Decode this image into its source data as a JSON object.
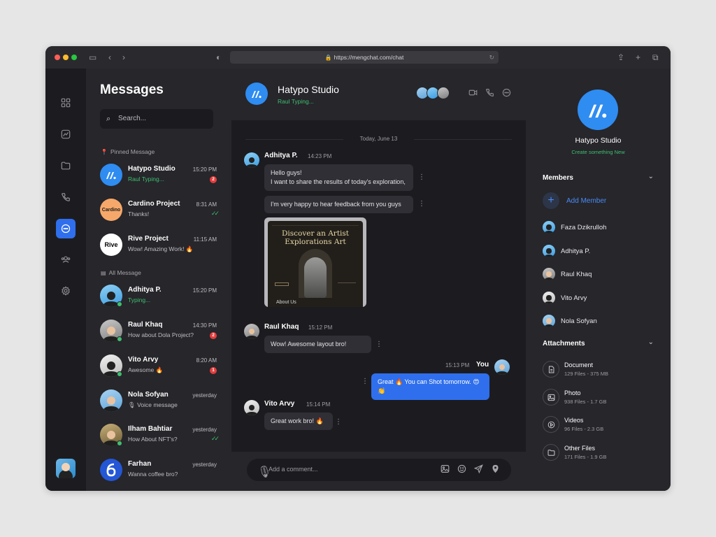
{
  "browser": {
    "url": "https://mengchat.com/chat"
  },
  "messages_panel": {
    "title": "Messages",
    "search_placeholder": "Search...",
    "pinned_label": "Pinned Message",
    "all_label": "All Message",
    "pinned": [
      {
        "name": "Hatypo Studio",
        "sub": "Raul Typing...",
        "time": "15:20 PM",
        "badge": "2"
      },
      {
        "name": "Cardino Project",
        "sub": "Thanks!",
        "time": "8:31 AM",
        "avatar_text": "Cardino"
      },
      {
        "name": "Rive Project",
        "sub": "Wow! Amazing Work! 🔥",
        "time": "11:15 AM",
        "avatar_text": "Rive"
      }
    ],
    "all": [
      {
        "name": "Adhitya P.",
        "sub": "Typing...",
        "time": "15:20 PM"
      },
      {
        "name": "Raul Khaq",
        "sub": "How about Dola Project?",
        "time": "14:30 PM",
        "badge": "2"
      },
      {
        "name": "Vito Arvy",
        "sub": "Awesome 🔥",
        "time": "8:20 AM",
        "badge": "1"
      },
      {
        "name": "Nola Sofyan",
        "sub": "Voice message",
        "time": "yesterday"
      },
      {
        "name": "Ilham Bahtiar",
        "sub": "How About NFT's?",
        "time": "yesterday"
      },
      {
        "name": "Farhan",
        "sub": "Wanna coffee bro?",
        "time": "yesterday"
      }
    ]
  },
  "chat": {
    "title": "Hatypo Studio",
    "status": "Raul Typing...",
    "date_separator": "Today, June 13",
    "messages": [
      {
        "sender": "Adhitya P.",
        "time": "14:23 PM",
        "bubble1_line1": "Hello guys!",
        "bubble1_line2": "I want to share the results of today's exploration,",
        "bubble2": "I'm very happy to hear feedback from you guys",
        "image_title_line1": "Discover an Artist",
        "image_title_line2": "Explorations Art",
        "image_caption": "About Us"
      },
      {
        "sender": "Raul Khaq",
        "time": "15:12 PM",
        "text": "Wow! Awesome layout bro!"
      },
      {
        "sender": "You",
        "time": "15:13 PM",
        "text": "Great 🔥 You can Shot tomorrow. 😍👏"
      },
      {
        "sender": "Vito Arvy",
        "time": "15:14 PM",
        "text": "Great work bro! 🔥"
      }
    ],
    "composer_placeholder": "Add a comment..."
  },
  "details": {
    "group_name": "Hatypo Studio",
    "group_subtitle": "Create something New",
    "members_label": "Members",
    "add_member_label": "Add Member",
    "members": [
      "Faza Dzikrulloh",
      "Adhitya P.",
      "Raul Khaq",
      "Vito Arvy",
      "Nola Sofyan"
    ],
    "attachments_label": "Attachments",
    "attachments": [
      {
        "name": "Document",
        "meta": "129 Files - 375 MB",
        "icon": "document-icon"
      },
      {
        "name": "Photo",
        "meta": "938 Files - 1.7 GB",
        "icon": "image-icon"
      },
      {
        "name": "Videos",
        "meta": "96 Files - 2.3 GB",
        "icon": "play-icon"
      },
      {
        "name": "Other Files",
        "meta": "171 Files - 1.9 GB",
        "icon": "folder-icon"
      }
    ]
  },
  "colors": {
    "accent": "#2f6fed",
    "online": "#3fbf6f",
    "badge": "#e53d3d",
    "brand": "#2f8cf1"
  }
}
